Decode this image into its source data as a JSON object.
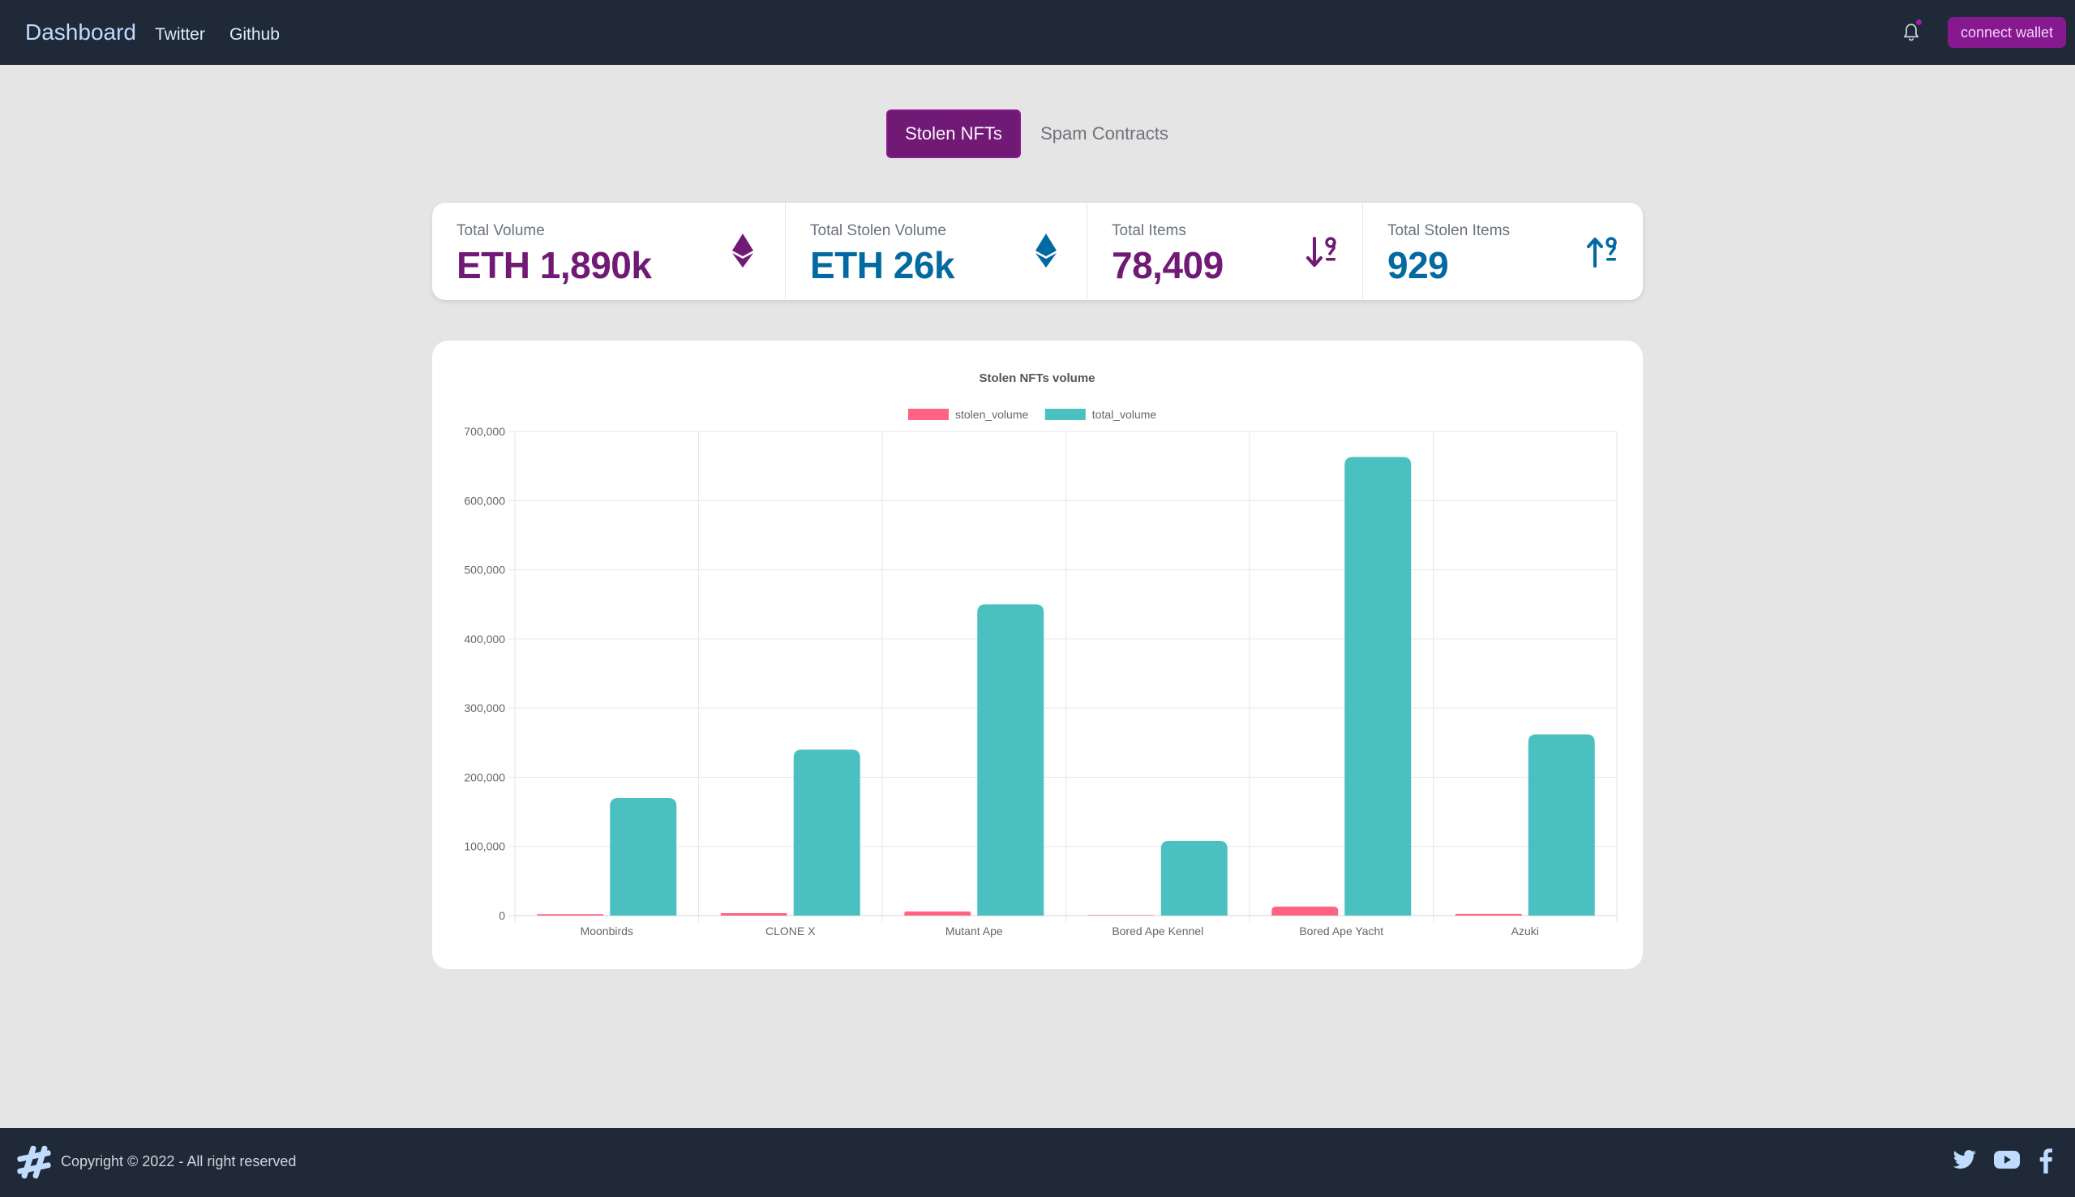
{
  "nav": {
    "brand": "Dashboard",
    "links": [
      "Twitter",
      "Github"
    ],
    "wallet_label": "connect wallet",
    "bell_icon": "bell-icon"
  },
  "tabs": {
    "active": "Stolen NFTs",
    "inactive": "Spam Contracts"
  },
  "stats": [
    {
      "title": "Total Volume",
      "value": "ETH 1,890k",
      "color": "#701a75",
      "icon": "ethereum-icon"
    },
    {
      "title": "Total Stolen Volume",
      "value": "ETH 26k",
      "color": "#0369a1",
      "icon": "ethereum-icon"
    },
    {
      "title": "Total Items",
      "value": "78,409",
      "color": "#701a75",
      "icon": "sort-descending-icon"
    },
    {
      "title": "Total Stolen Items",
      "value": "929",
      "color": "#0369a1",
      "icon": "sort-ascending-icon"
    }
  ],
  "chart_data": {
    "type": "bar",
    "title": "Stolen NFTs volume",
    "categories": [
      "Moonbirds",
      "CLONE X",
      "Mutant Ape",
      "Bored Ape Kennel",
      "Bored Ape Yacht",
      "Azuki"
    ],
    "series": [
      {
        "name": "stolen_volume",
        "color": "#ff6384",
        "values": [
          2000,
          3500,
          6000,
          800,
          13000,
          2500
        ]
      },
      {
        "name": "total_volume",
        "color": "#4bc0c0",
        "values": [
          170000,
          240000,
          450000,
          108000,
          663000,
          262000
        ]
      }
    ],
    "ylim": [
      0,
      700000
    ],
    "yticks": [
      "0",
      "100,000",
      "200,000",
      "300,000",
      "400,000",
      "500,000",
      "600,000",
      "700,000"
    ],
    "legend": "top",
    "grid": true
  },
  "footer": {
    "copyright": "Copyright © 2022 - All right reserved",
    "logo_icon": "hashtag-logo-icon",
    "social": [
      "twitter-icon",
      "youtube-icon",
      "facebook-icon"
    ]
  }
}
